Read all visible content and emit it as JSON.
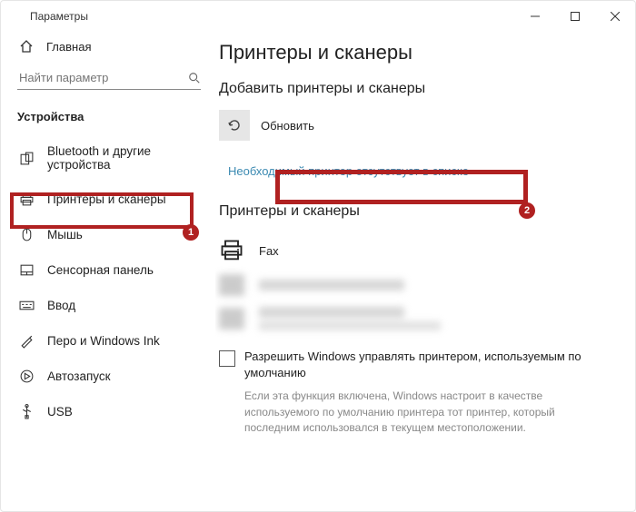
{
  "titlebar": {
    "title": "Параметры"
  },
  "sidebar": {
    "home": "Главная",
    "search_placeholder": "Найти параметр",
    "section": "Устройства",
    "items": [
      "Bluetooth и другие устройства",
      "Принтеры и сканеры",
      "Мышь",
      "Сенсорная панель",
      "Ввод",
      "Перо и Windows Ink",
      "Автозапуск",
      "USB"
    ]
  },
  "main": {
    "title": "Принтеры и сканеры",
    "add_section": "Добавить принтеры и сканеры",
    "refresh": "Обновить",
    "missing_link": "Необходимый принтер отсутствует в списке",
    "list_section": "Принтеры и сканеры",
    "device0": "Fax",
    "checkbox_label": "Разрешить Windows управлять принтером, используемым по умолчанию",
    "help": "Если эта функция включена, Windows настроит в качестве используемого по умолчанию принтера тот принтер, который последним использовался в текущем местоположении."
  },
  "callouts": {
    "b1": "1",
    "b2": "2"
  }
}
